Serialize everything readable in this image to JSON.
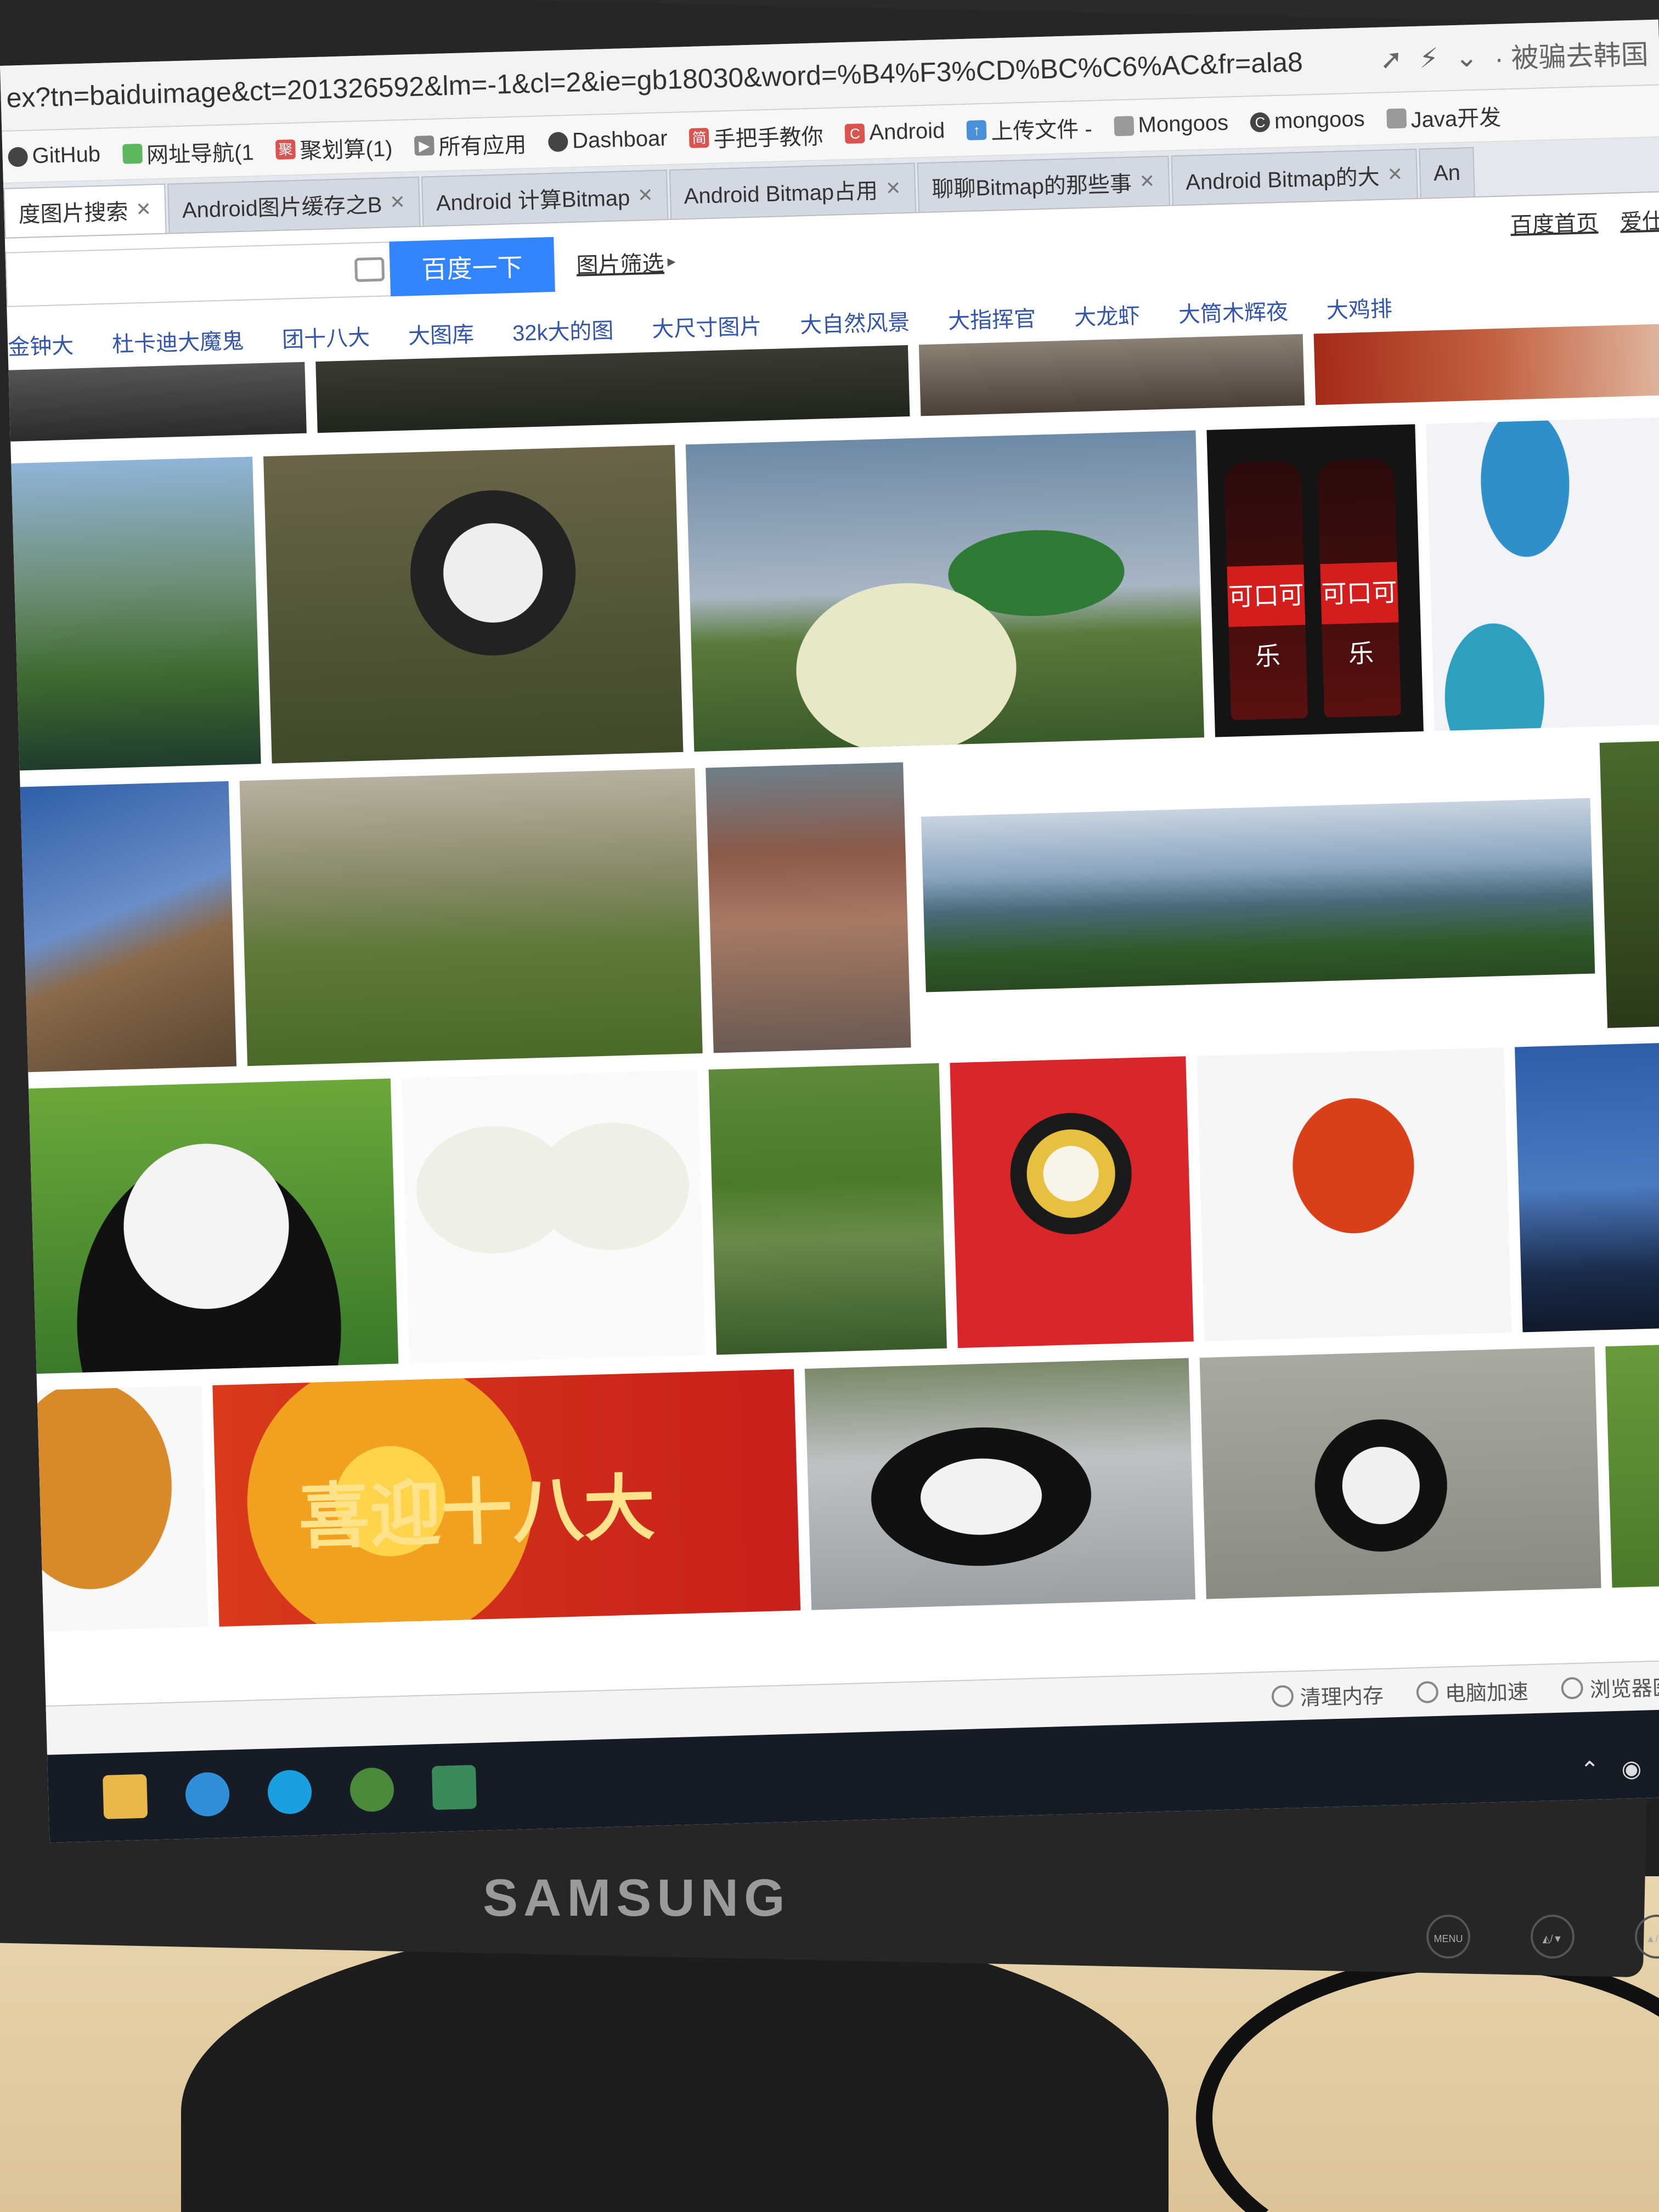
{
  "address_bar": {
    "url": "ex?tn=baiduimage&ct=201326592&lm=-1&cl=2&ie=gb18030&word=%B4%F3%CD%BC%C6%AC&fr=ala8",
    "side_text": "· 被骗去韩国"
  },
  "bookmarks": [
    {
      "label": "GitHub",
      "icon": "github-icon"
    },
    {
      "label": "网址导航(1",
      "icon": "nav-icon"
    },
    {
      "label": "聚划算(1)",
      "icon": "juhuasuan-icon"
    },
    {
      "label": "所有应用",
      "icon": "apps-icon"
    },
    {
      "label": "Dashboar",
      "icon": "github-icon"
    },
    {
      "label": "手把手教你",
      "icon": "jianshu-icon"
    },
    {
      "label": "Android",
      "icon": "csdn-icon"
    },
    {
      "label": "上传文件 -",
      "icon": "upload-icon"
    },
    {
      "label": "Mongoos",
      "icon": "bookmark-icon"
    },
    {
      "label": "mongoos",
      "icon": "csdn-icon"
    },
    {
      "label": "Java开发",
      "icon": "bookmark-icon"
    }
  ],
  "tabs": [
    {
      "label": "度图片搜索",
      "active": true
    },
    {
      "label": "Android图片缓存之B",
      "active": false
    },
    {
      "label": "Android 计算Bitmap",
      "active": false
    },
    {
      "label": "Android Bitmap占用",
      "active": false
    },
    {
      "label": "聊聊Bitmap的那些事",
      "active": false
    },
    {
      "label": "Android Bitmap的大",
      "active": false
    },
    {
      "label": "An",
      "active": false
    }
  ],
  "search": {
    "button_label": "百度一下",
    "filter_label": "图片筛选",
    "toplinks": [
      "百度首页",
      "爱仕"
    ]
  },
  "related_searches": [
    "金钟大",
    "杜卡迪大魔鬼",
    "团十八大",
    "大图库",
    "32k大的图",
    "大尺寸图片",
    "大自然风景",
    "大指挥官",
    "大龙虾",
    "大筒木辉夜",
    "大鸡排"
  ],
  "images": {
    "banner_caption": "喜迎十八大",
    "coke_label": "可口可乐"
  },
  "statusbar": [
    "清理内存",
    "电脑加速",
    "浏览器医生"
  ],
  "monitor": {
    "brand": "SAMSUNG",
    "buttons": [
      "MENU",
      "◭/▼",
      "▲/▼"
    ]
  },
  "colors": {
    "search_button": "#3385ff",
    "link": "#3355aa",
    "taskbar": "#151c26"
  }
}
